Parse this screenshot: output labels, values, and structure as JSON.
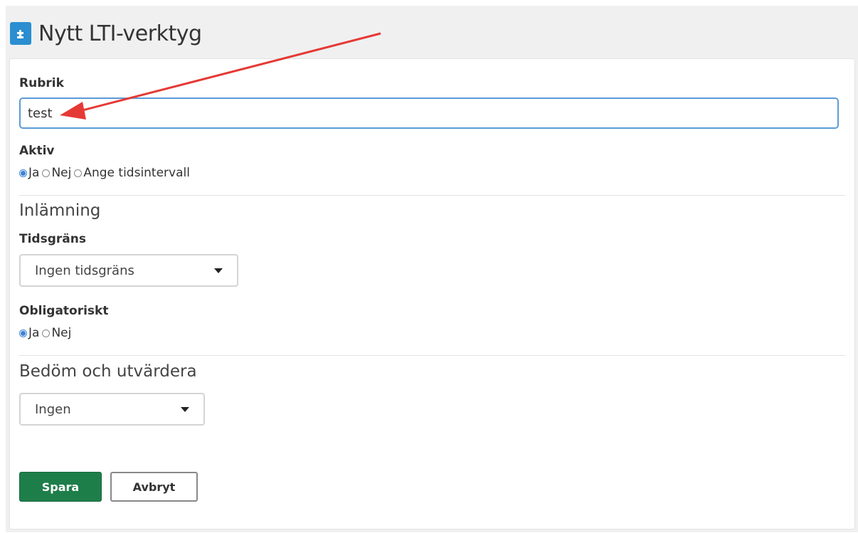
{
  "header": {
    "title": "Nytt LTI-verktyg",
    "icon": "puzzle-document-icon",
    "icon_color": "#2a8ed0"
  },
  "form": {
    "rubrik": {
      "label": "Rubrik",
      "value": "test"
    },
    "aktiv": {
      "label": "Aktiv",
      "options": [
        "Ja",
        "Nej",
        "Ange tidsintervall"
      ],
      "selected": "Ja"
    },
    "inlamning": {
      "section_title": "Inlämning",
      "tidsgrans": {
        "label": "Tidsgräns",
        "selected": "Ingen tidsgräns"
      }
    },
    "obligatoriskt": {
      "label": "Obligatoriskt",
      "options": [
        "Ja",
        "Nej"
      ],
      "selected": "Ja"
    },
    "bedom": {
      "section_title": "Bedöm och utvärdera",
      "selected": "Ingen"
    }
  },
  "actions": {
    "save_label": "Spara",
    "cancel_label": "Avbryt",
    "save_color": "#1e7e4a"
  },
  "annotation": {
    "arrow_color": "#e53935"
  }
}
